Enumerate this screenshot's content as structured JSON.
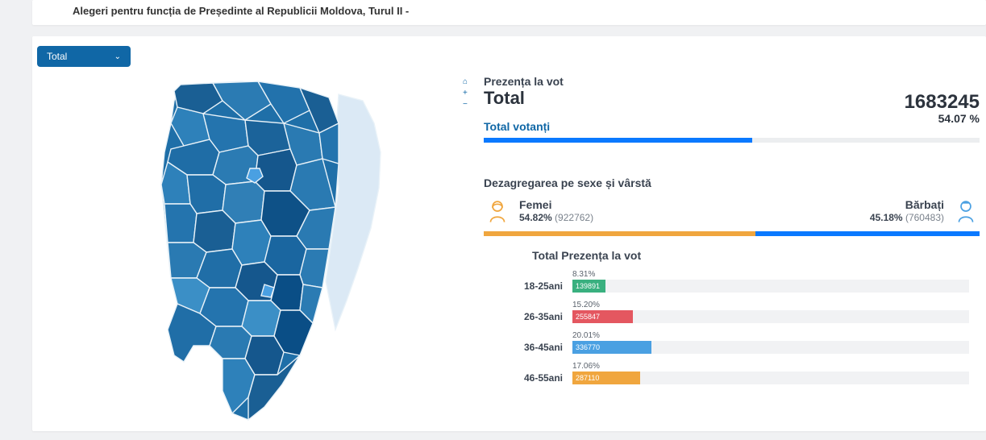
{
  "title": "Alegeri pentru funcția de Președinte al Republicii Moldova, Turul II -",
  "dropdown": {
    "label": "Total"
  },
  "turnout": {
    "heading_small": "Prezența la vot",
    "heading_big": "Total",
    "total_count": "1683245",
    "total_pct": "54.07 %",
    "voters_label": "Total votanți",
    "voters_bar_pct": 54.07
  },
  "gender": {
    "section_title": "Dezagregarea pe sexe și vârstă",
    "female": {
      "label": "Femei",
      "pct": "54.82%",
      "count": "(922762)",
      "bar": 54.82
    },
    "male": {
      "label": "Bărbați",
      "pct": "45.18%",
      "count": "(760483)",
      "bar": 45.18
    }
  },
  "age": {
    "title": "Total Prezența la vot",
    "max_count": 1683245,
    "rows": [
      {
        "label": "18-25ani",
        "pct": "8.31%",
        "count": "139891",
        "color": "#39b07f",
        "frac": 0.0831
      },
      {
        "label": "26-35ani",
        "pct": "15.20%",
        "count": "255847",
        "color": "#e45760",
        "frac": 0.152
      },
      {
        "label": "36-45ani",
        "pct": "20.01%",
        "count": "336770",
        "color": "#4aa0e2",
        "frac": 0.2001
      },
      {
        "label": "46-55ani",
        "pct": "17.06%",
        "count": "287110",
        "color": "#f0a63e",
        "frac": 0.1706
      }
    ]
  },
  "chart_data": [
    {
      "type": "bar",
      "title": "Total votanți",
      "categories": [
        "Total votanți"
      ],
      "values": [
        54.07
      ],
      "ylim": [
        0,
        100
      ],
      "note": "turnout percent; absolute count 1683245"
    },
    {
      "type": "bar",
      "title": "Dezagregarea pe sexe",
      "categories": [
        "Femei",
        "Bărbați"
      ],
      "series": [
        {
          "name": "percent",
          "values": [
            54.82,
            45.18
          ]
        },
        {
          "name": "count",
          "values": [
            922762,
            760483
          ]
        }
      ],
      "ylim": [
        0,
        100
      ]
    },
    {
      "type": "bar",
      "title": "Total Prezența la vot",
      "categories": [
        "18-25ani",
        "26-35ani",
        "36-45ani",
        "46-55ani"
      ],
      "series": [
        {
          "name": "percent",
          "values": [
            8.31,
            15.2,
            20.01,
            17.06
          ]
        },
        {
          "name": "count",
          "values": [
            139891,
            255847,
            336770,
            287110
          ]
        }
      ],
      "xlabel": "",
      "ylabel": "",
      "ylim": [
        0,
        100
      ]
    }
  ]
}
